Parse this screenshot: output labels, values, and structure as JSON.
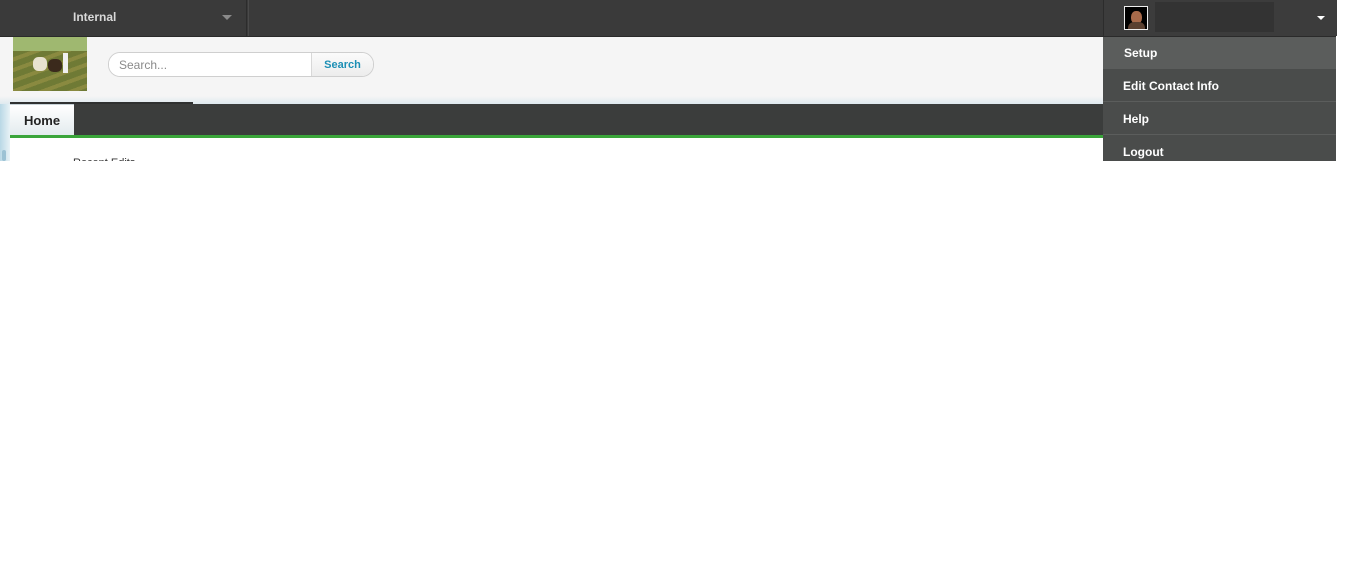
{
  "community": {
    "label": "Internal"
  },
  "search": {
    "placeholder": "Search...",
    "button_label": "Search"
  },
  "tabs": [
    {
      "label": "Home"
    }
  ],
  "page": {
    "partial_text": "Recent Edits"
  },
  "user_menu": {
    "items": [
      {
        "label": "Setup"
      },
      {
        "label": "Edit Contact Info"
      },
      {
        "label": "Help"
      },
      {
        "label": "Logout"
      }
    ]
  },
  "colors": {
    "topbar": "#3a3a3a",
    "tab_underline": "#3aa53a",
    "search_button_text": "#1c8fb5",
    "menu_bg": "#4a4c4b"
  }
}
